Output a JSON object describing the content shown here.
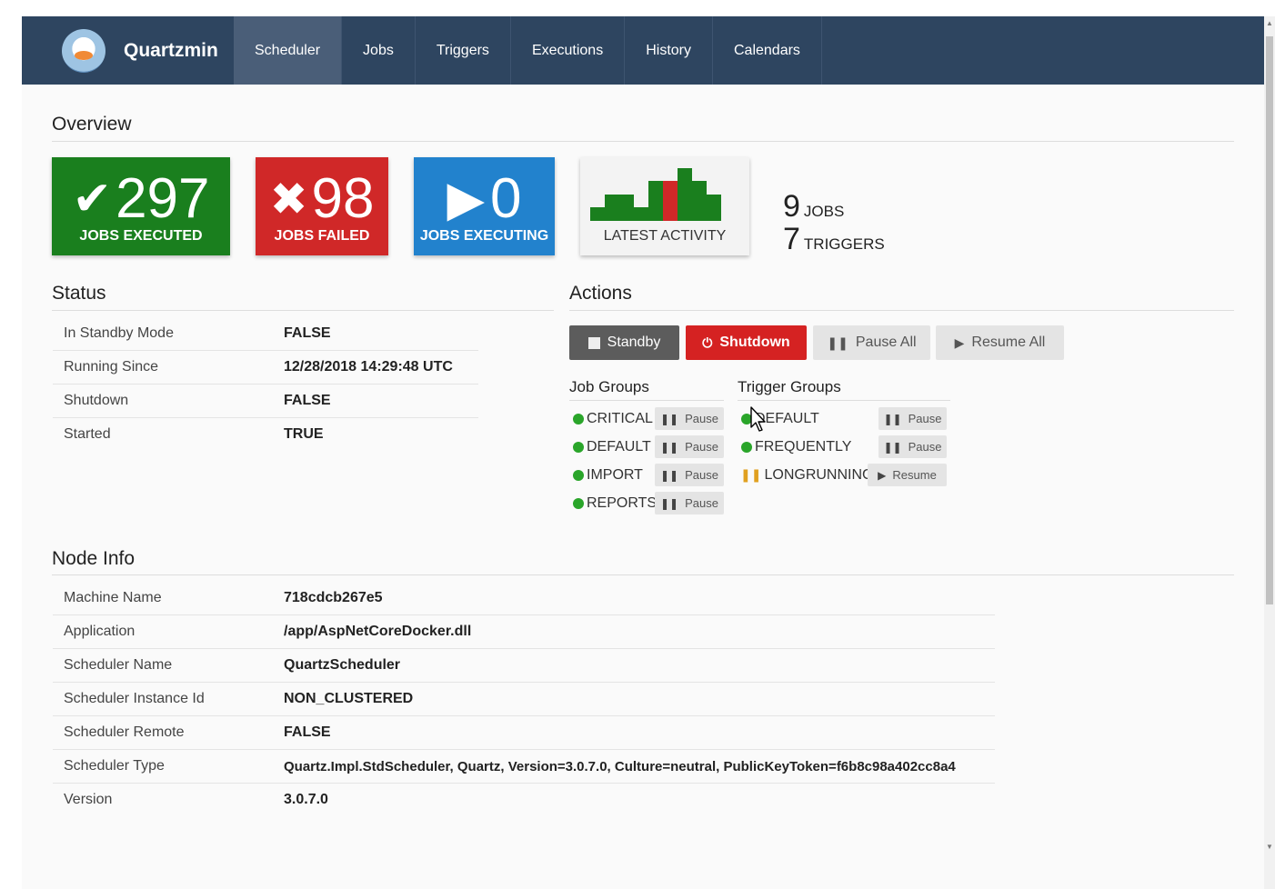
{
  "nav": {
    "brand": "Quartzmin",
    "items": [
      "Scheduler",
      "Jobs",
      "Triggers",
      "Executions",
      "History",
      "Calendars"
    ]
  },
  "overview": {
    "title": "Overview",
    "executed": {
      "value": "297",
      "label": "JOBS EXECUTED"
    },
    "failed": {
      "value": "98",
      "label": "JOBS FAILED"
    },
    "executing": {
      "value": "0",
      "label": "JOBS EXECUTING"
    },
    "activity": {
      "label": "LATEST ACTIVITY"
    },
    "jobs": {
      "value": "9",
      "label": "JOBS"
    },
    "triggers": {
      "value": "7",
      "label": "TRIGGERS"
    }
  },
  "status": {
    "title": "Status",
    "rows": [
      {
        "key": "In Standby Mode",
        "value": "FALSE"
      },
      {
        "key": "Running Since",
        "value": "12/28/2018 14:29:48 UTC"
      },
      {
        "key": "Shutdown",
        "value": "FALSE"
      },
      {
        "key": "Started",
        "value": "TRUE"
      }
    ]
  },
  "actions": {
    "title": "Actions",
    "standby": "Standby",
    "shutdown": "Shutdown",
    "pause_all": "Pause All",
    "resume_all": "Resume All"
  },
  "job_groups": {
    "title": "Job Groups",
    "items": [
      {
        "name": "CRITICAL",
        "action": "Pause"
      },
      {
        "name": "DEFAULT",
        "action": "Pause"
      },
      {
        "name": "IMPORT",
        "action": "Pause"
      },
      {
        "name": "REPORTS",
        "action": "Pause"
      }
    ]
  },
  "trigger_groups": {
    "title": "Trigger Groups",
    "items": [
      {
        "name": "DEFAULT",
        "action": "Pause"
      },
      {
        "name": "FREQUENTLY",
        "action": "Pause"
      },
      {
        "name": "LONGRUNNING",
        "action": "Resume"
      }
    ]
  },
  "node_info": {
    "title": "Node Info",
    "rows": [
      {
        "key": "Machine Name",
        "value": "718cdcb267e5"
      },
      {
        "key": "Application",
        "value": "/app/AspNetCoreDocker.dll"
      },
      {
        "key": "Scheduler Name",
        "value": "QuartzScheduler"
      },
      {
        "key": "Scheduler Instance Id",
        "value": "NON_CLUSTERED"
      },
      {
        "key": "Scheduler Remote",
        "value": "FALSE"
      },
      {
        "key": "Scheduler Type",
        "value": "Quartz.Impl.StdScheduler, Quartz, Version=3.0.7.0, Culture=neutral, PublicKeyToken=f6b8c98a402cc8a4"
      },
      {
        "key": "Version",
        "value": "3.0.7.0"
      }
    ]
  },
  "activity_bars": [
    {
      "level": 0.25,
      "color": "#1a7f1e"
    },
    {
      "level": 0.5,
      "color": "#1a7f1e"
    },
    {
      "level": 0.5,
      "color": "#1a7f1e"
    },
    {
      "level": 0.25,
      "color": "#1a7f1e"
    },
    {
      "level": 0.75,
      "color": "#1a7f1e"
    },
    {
      "level": 0.75,
      "color": "#d02828"
    },
    {
      "level": 1.0,
      "color": "#1a7f1e"
    },
    {
      "level": 0.75,
      "color": "#1a7f1e"
    },
    {
      "level": 0.5,
      "color": "#1a7f1e"
    }
  ]
}
